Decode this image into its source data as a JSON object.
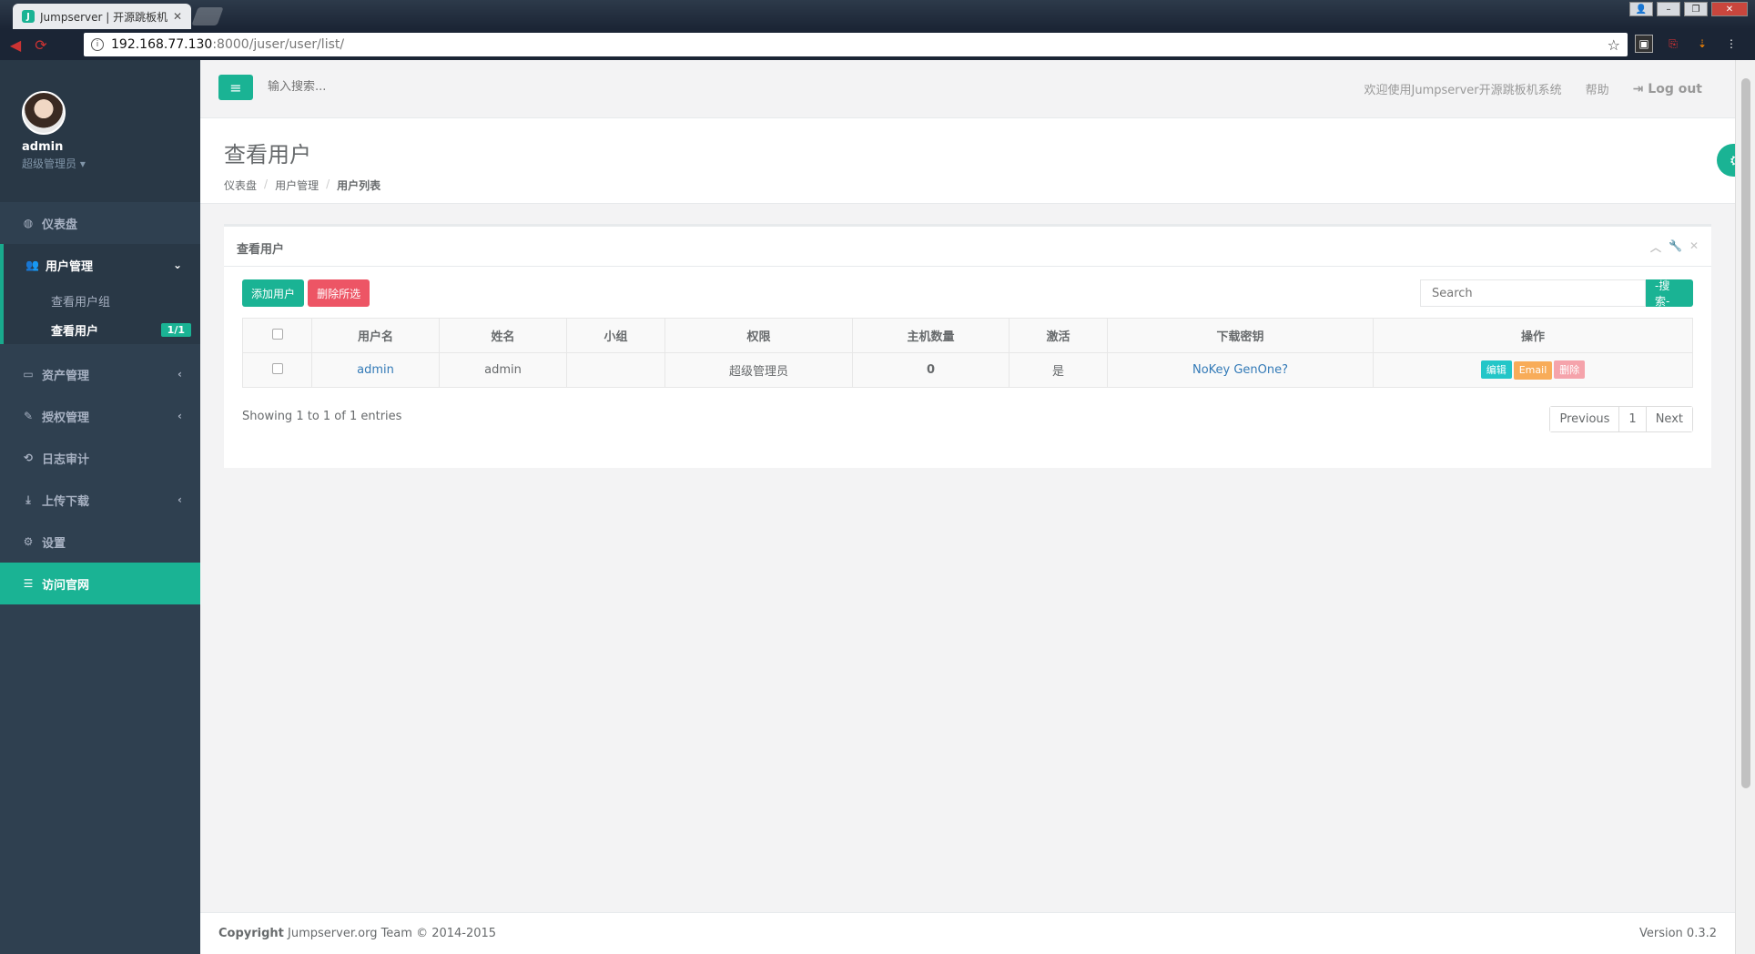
{
  "browser": {
    "tab_title": "Jumpserver | 开源跳板机",
    "url_host": "192.168.77.130",
    "url_path": ":8000/juser/user/list/"
  },
  "sidebar": {
    "profile_name": "admin",
    "profile_role": "超级管理员 ▾",
    "items": [
      {
        "label": "仪表盘"
      },
      {
        "label": "用户管理"
      },
      {
        "label": "资产管理"
      },
      {
        "label": "授权管理"
      },
      {
        "label": "日志审计"
      },
      {
        "label": "上传下载"
      },
      {
        "label": "设置"
      },
      {
        "label": "访问官网"
      }
    ],
    "sub_items": [
      {
        "label": "查看用户组"
      },
      {
        "label": "查看用户",
        "badge": "1/1"
      }
    ]
  },
  "topbar": {
    "search_placeholder": "输入搜索...",
    "welcome": "欢迎使用Jumpserver开源跳板机系统",
    "help": "帮助",
    "logout": "Log out"
  },
  "heading": {
    "title": "查看用户",
    "breadcrumb": [
      "仪表盘",
      "用户管理",
      "用户列表"
    ]
  },
  "panel": {
    "title": "查看用户",
    "add_button": "添加用户",
    "delete_button": "删除所选",
    "search_placeholder": "Search",
    "search_button": "-搜索-",
    "columns": [
      "用户名",
      "姓名",
      "小组",
      "权限",
      "主机数量",
      "激活",
      "下载密钥",
      "操作"
    ],
    "rows": [
      {
        "username": "admin",
        "name": "admin",
        "group": "",
        "role": "超级管理员",
        "hosts": "0",
        "active": "是",
        "key": "NoKey GenOne?",
        "actions": [
          "编辑",
          "Email",
          "删除"
        ]
      }
    ],
    "showing": "Showing 1 to 1 of 1 entries",
    "pagination": {
      "prev": "Previous",
      "page": "1",
      "next": "Next"
    }
  },
  "footer": {
    "copyright_bold": "Copyright",
    "copyright_rest": " Jumpserver.org Team © 2014-2015",
    "version": "Version 0.3.2"
  },
  "colors": {
    "accent": "#1ab394",
    "sidebar": "#2f4050",
    "danger": "#ed5565"
  }
}
